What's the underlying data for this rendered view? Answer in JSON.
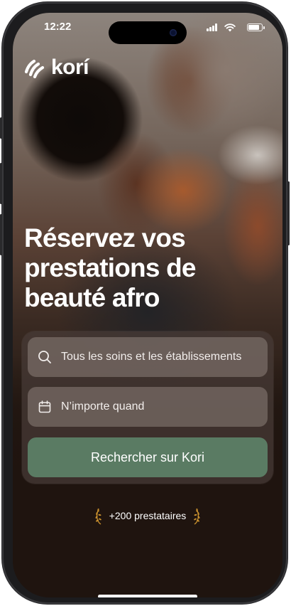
{
  "status_bar": {
    "time": "12:22",
    "signal_icon": "cellular-signal-icon",
    "wifi_icon": "wifi-icon",
    "battery_icon": "battery-icon",
    "battery_level": 0.85
  },
  "brand": {
    "name": "korí",
    "logo_icon": "kori-logo-icon"
  },
  "hero": {
    "title": "Réservez vos prestations de beauté afro"
  },
  "search": {
    "services_icon": "search-icon",
    "services_placeholder": "Tous les soins et les établissements",
    "date_icon": "calendar-icon",
    "date_placeholder": "N’importe quand",
    "button_label": "Rechercher sur Kori"
  },
  "social_proof": {
    "text": "+200 prestataires",
    "icon": "laurel-icon"
  },
  "colors": {
    "button_green": "#5a7b63",
    "laurel_gold": "#c8902e",
    "background": "#1f140f"
  }
}
